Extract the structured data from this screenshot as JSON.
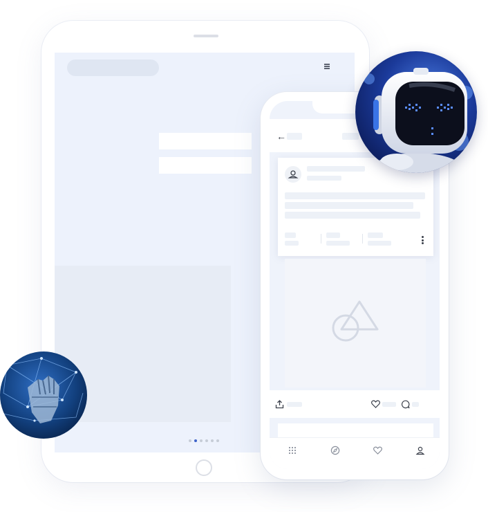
{
  "tablet": {
    "menu_icon": "hamburger-icon",
    "pagination": {
      "count": 6,
      "active": 1
    },
    "accent_color": "#3d63c9"
  },
  "phone": {
    "header": {
      "back_icon": "back-arrow-icon",
      "back_glyph": "←"
    },
    "post": {
      "avatar_icon": "user-icon",
      "menu_icon": "more-vertical-icon",
      "media_icon": "shapes-placeholder-icon"
    },
    "actions": {
      "share_icon": "share-icon",
      "like_icon": "heart-icon",
      "comment_icon": "comment-icon"
    },
    "bottom_nav": [
      {
        "name": "grid",
        "icon": "grid-icon"
      },
      {
        "name": "explore",
        "icon": "compass-icon"
      },
      {
        "name": "likes",
        "icon": "heart-icon"
      },
      {
        "name": "profile",
        "icon": "user-icon"
      }
    ]
  },
  "images": {
    "robot": "robot-photo",
    "hand": "robot-hand-photo"
  },
  "colors": {
    "background": "#ffffff",
    "screen": "#edf2fc",
    "placeholder": "#edf1f7",
    "icon": "#3a3f4a"
  }
}
